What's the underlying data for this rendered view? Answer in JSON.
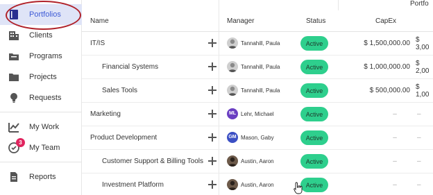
{
  "sidebar": {
    "items": [
      {
        "label": "Portfolios",
        "icon": "portfolio-icon",
        "active": true
      },
      {
        "label": "Clients",
        "icon": "building-icon"
      },
      {
        "label": "Programs",
        "icon": "programs-folder-icon"
      },
      {
        "label": "Projects",
        "icon": "folder-icon"
      },
      {
        "label": "Requests",
        "icon": "lightbulb-icon"
      },
      {
        "label": "My Work",
        "icon": "chart-check-icon"
      },
      {
        "label": "My Team",
        "icon": "team-icon",
        "badge": "3"
      },
      {
        "label": "Reports",
        "icon": "report-icon"
      }
    ]
  },
  "table": {
    "group_header": "Portfo",
    "headers": {
      "name": "Name",
      "manager": "Manager",
      "status": "Status",
      "capex": "CapEx"
    },
    "rows": [
      {
        "name": "IT/IS",
        "indent": false,
        "manager": "Tannahill, Paula",
        "avatar": "photo",
        "status": "Active",
        "capex": "$ 1,500,000.00",
        "next": "$ 3,00"
      },
      {
        "name": "Financial Systems",
        "indent": true,
        "manager": "Tannahill, Paula",
        "avatar": "photo",
        "status": "Active",
        "capex": "$ 1,000,000.00",
        "next": "$ 2,00"
      },
      {
        "name": "Sales Tools",
        "indent": true,
        "manager": "Tannahill, Paula",
        "avatar": "photo",
        "status": "Active",
        "capex": "$ 500,000.00",
        "next": "$ 1,00"
      },
      {
        "name": "Marketing",
        "indent": false,
        "manager": "Lehr, Michael",
        "avatar": "initials",
        "initials": "ML",
        "avatar_color": "#6a3ec2",
        "status": "Active",
        "capex": "–",
        "next": "–"
      },
      {
        "name": "Product Development",
        "indent": false,
        "manager": "Mason, Gaby",
        "avatar": "initials",
        "initials": "GM",
        "avatar_color": "#3b4fc4",
        "status": "Active",
        "capex": "–",
        "next": "–"
      },
      {
        "name": "Customer Support & Billing Tools",
        "indent": true,
        "manager": "Austin, Aaron",
        "avatar": "photo-dark",
        "status": "Active",
        "capex": "–",
        "next": "–"
      },
      {
        "name": "Investment Platform",
        "indent": true,
        "manager": "Austin, Aaron",
        "avatar": "photo-dark",
        "status": "Active",
        "capex": "–",
        "next": "–"
      }
    ]
  },
  "colors": {
    "accent": "#3d5ad6",
    "active_nav_bg": "#dfe4f7",
    "status_green": "#2ecf8d",
    "badge_red": "#e0245e",
    "highlight_red": "#b0222a"
  }
}
